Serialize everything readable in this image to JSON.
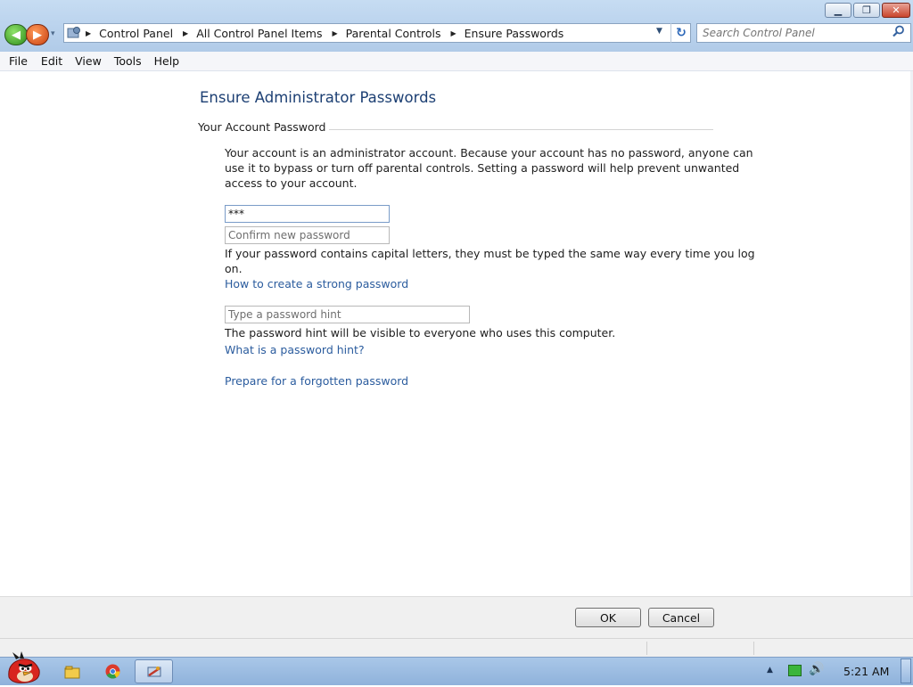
{
  "window": {
    "minimize_glyph": "▁",
    "maximize_glyph": "❐",
    "close_glyph": "✕"
  },
  "navigation": {
    "back_glyph": "◀",
    "forward_glyph": "▶",
    "recent_glyph": "▾"
  },
  "address": {
    "breadcrumbs": [
      "Control Panel",
      "All Control Panel Items",
      "Parental Controls",
      "Ensure Passwords"
    ],
    "separator_glyph": "▶",
    "dropdown_glyph": "▼",
    "refresh_glyph": "↻"
  },
  "search": {
    "placeholder": "Search Control Panel",
    "icon": "search-icon"
  },
  "menu": {
    "items": [
      "File",
      "Edit",
      "View",
      "Tools",
      "Help"
    ]
  },
  "main": {
    "title": "Ensure Administrator Passwords",
    "section_heading": "Your Account Password",
    "description_lines": [
      "Your account is an administrator account. Because your account has no password, anyone can",
      "use it to bypass or turn off parental controls. Setting a password will help prevent unwanted",
      "access to your account."
    ],
    "new_password_value": "***",
    "confirm_placeholder": "Confirm new password",
    "caps_note_lines": [
      "If your password contains capital letters, they must be typed the same way every time you log",
      "on."
    ],
    "strong_password_link": "How to create a strong password",
    "hint_placeholder": "Type a password hint",
    "hint_note": "The password hint will be visible to everyone who uses this computer.",
    "what_is_hint_link": "What is a password hint?",
    "forgotten_link": "Prepare for a forgotten password"
  },
  "footer": {
    "ok_label": "OK",
    "cancel_label": "Cancel"
  },
  "taskbar": {
    "folder_glyph": "▣",
    "clock": "5:21 AM",
    "tray_arrow_glyph": "▲",
    "speaker_glyph": "🔊"
  },
  "colors": {
    "title_blue": "#1c3f73",
    "link_blue": "#2b5c9e",
    "taskbar": "#9fbfe3"
  }
}
